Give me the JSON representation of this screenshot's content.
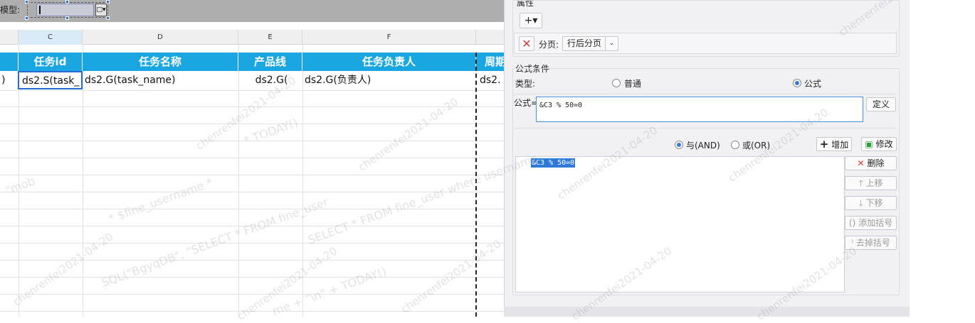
{
  "toolbar": {
    "page_type_label": "模型:",
    "dropdown_glyph": "□▾"
  },
  "sheet": {
    "columns": [
      "C",
      "D",
      "E",
      "F"
    ],
    "header_row": [
      "任务id",
      "任务名称",
      "产品线",
      "任务负责人",
      "周期"
    ],
    "data_row": {
      "left_cut": ")",
      "c": "ds2.S(task_",
      "d": "ds2.G(task_name)",
      "e": "ds2.G(",
      "f": "ds2.G(负责人)",
      "g": "ds2."
    }
  },
  "panel": {
    "attr_label": "属性",
    "add_glyph": "+▾",
    "paging": {
      "label": "分页:",
      "value": "行后分页"
    },
    "formula_condition_label": "公式条件",
    "type_label": "类型:",
    "type_options": [
      "普通",
      "公式"
    ],
    "formula_label": "公式=",
    "formula_value": "&C3 % 50=0",
    "define_label": "定义",
    "logic_options": [
      "与(AND)",
      "或(OR)"
    ],
    "add_label": "增加",
    "modify_label": "修改",
    "conditions": [
      "&C3 % 50=0"
    ],
    "side_buttons": [
      "删除",
      "上移",
      "下移",
      "添加括号",
      "去掉括号"
    ]
  },
  "watermark": {
    "user_stamp": "chenrenfei2021-04-20",
    "fragments": [
      "* $fine_username *",
      "SELECT * FROM fine_user where username",
      "* TODAY()",
      "SQL(\"BgyqDB\", \"SELECT * FROM fine_user",
      "me + \"\\n\" + TODAY()",
      "\"mob"
    ]
  },
  "colors": {
    "header_blue": "#1aa6e0",
    "selection_blue": "#2a6cd6",
    "delete_red": "#d23c3c"
  }
}
